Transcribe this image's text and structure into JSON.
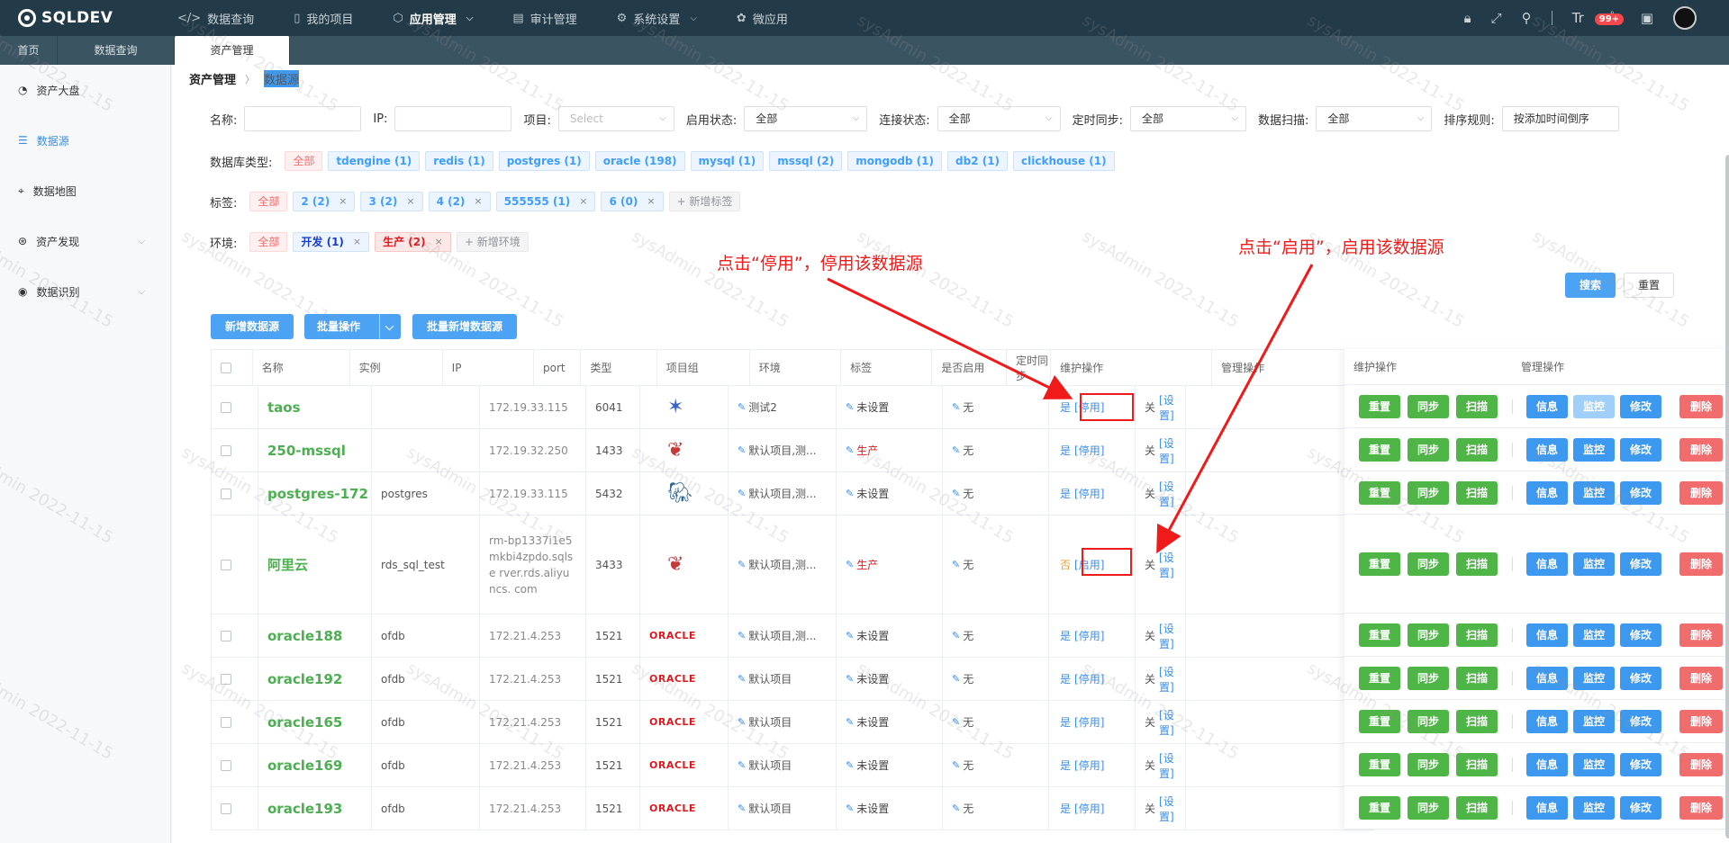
{
  "app": {
    "logo": "SQLDEV"
  },
  "nav": [
    {
      "label": "数据查询",
      "icon": "code-icon"
    },
    {
      "label": "我的项目",
      "icon": "folder-icon"
    },
    {
      "label": "应用管理",
      "icon": "cube-icon",
      "active": true,
      "has_menu": true
    },
    {
      "label": "审计管理",
      "icon": "doc-icon"
    },
    {
      "label": "系统设置",
      "icon": "gear-icon",
      "has_menu": true
    },
    {
      "label": "微应用",
      "icon": "flower-icon"
    }
  ],
  "toolbar": {
    "badge": "99+",
    "font_icon": "Tr"
  },
  "tabs": [
    {
      "label": "首页"
    },
    {
      "label": "数据查询"
    },
    {
      "label": "资产管理",
      "active": true
    }
  ],
  "sidebar": [
    {
      "label": "资产大盘",
      "icon": "pie-chart-icon"
    },
    {
      "label": "数据源",
      "icon": "database-icon",
      "active": true
    },
    {
      "label": "数据地图",
      "icon": "map-pin-icon"
    },
    {
      "label": "资产发现",
      "icon": "discover-icon",
      "has_menu": true
    },
    {
      "label": "数据识别",
      "icon": "eye-icon",
      "has_menu": true
    }
  ],
  "breadcrumb": {
    "root": "资产管理",
    "current": "数据源"
  },
  "filters": {
    "name_label": "名称:",
    "ip_label": "IP:",
    "project_label": "项目:",
    "project_placeholder": "Select",
    "enable_label": "启用状态:",
    "enable_value": "全部",
    "conn_label": "连接状态:",
    "conn_value": "全部",
    "sync_label": "定时同步:",
    "sync_value": "全部",
    "scan_label": "数据扫描:",
    "scan_value": "全部",
    "sort_label": "排序规则:",
    "sort_value": "按添加时间倒序"
  },
  "dbtypes": {
    "label": "数据库类型:",
    "all": "全部",
    "items": [
      "tdengine (1)",
      "redis (1)",
      "postgres (1)",
      "oracle (198)",
      "mysql (1)",
      "mssql (2)",
      "mongodb (1)",
      "db2 (1)",
      "clickhouse (1)"
    ]
  },
  "tags": {
    "label": "标签:",
    "all": "全部",
    "items": [
      "2 (2)",
      "3 (2)",
      "4 (2)",
      "555555 (1)",
      "6 (0)"
    ],
    "add": "+ 新增标签"
  },
  "envs": {
    "label": "环境:",
    "all": "全部",
    "dev": "开发 (1)",
    "prod": "生产 (2)",
    "add": "+ 新增环境"
  },
  "actions": {
    "search": "搜索",
    "reset": "重置",
    "new_ds": "新增数据源",
    "batch_ops": "批量操作",
    "batch_new": "批量新增数据源"
  },
  "annotations": {
    "disable": "点击“停用”，停用该数据源",
    "enable": "点击“启用”，启用该数据源"
  },
  "table": {
    "headers": [
      "名称",
      "实例",
      "IP",
      "port",
      "类型",
      "项目组",
      "环境",
      "标签",
      "是否启用",
      "定时同步",
      "维护操作",
      "管理操作"
    ],
    "rows": [
      {
        "name": "taos",
        "instance": "",
        "ip": "172.19.33.115",
        "port": "6041",
        "type": "tdengine",
        "project": "测试2",
        "env": "未设置",
        "env_prod": false,
        "tag": "无",
        "enabled": "是",
        "toggle": "[停用]",
        "sync": "关",
        "sync_link": "[设置]",
        "monitor_disabled": true
      },
      {
        "name": "250-mssql",
        "instance": "",
        "ip": "172.19.32.250",
        "port": "1433",
        "type": "mssql",
        "project": "默认项目,测...",
        "env": "生产",
        "env_prod": true,
        "tag": "无",
        "enabled": "是",
        "toggle": "[停用]",
        "sync": "关",
        "sync_link": "[设置]"
      },
      {
        "name": "postgres-172",
        "instance": "postgres",
        "ip": "172.19.33.115",
        "port": "5432",
        "type": "postgres",
        "project": "默认项目,测...",
        "env": "未设置",
        "env_prod": false,
        "tag": "无",
        "enabled": "是",
        "toggle": "[停用]",
        "sync": "关",
        "sync_link": "[设置]"
      },
      {
        "name": "阿里云",
        "instance": "rds_sql_test",
        "ip": "rm-bp1337i1e5 mkbi4zpdo.sqlse rver.rds.aliyuncs. com",
        "port": "3433",
        "type": "mssql",
        "project": "默认项目,测...",
        "env": "生产",
        "env_prod": true,
        "tag": "无",
        "enabled": "否",
        "toggle": "[启用]",
        "sync": "关",
        "sync_link": "[设置]",
        "tall": true
      },
      {
        "name": "oracle188",
        "instance": "ofdb",
        "ip": "172.21.4.253",
        "port": "1521",
        "type": "oracle",
        "project": "默认项目,测...",
        "env": "未设置",
        "env_prod": false,
        "tag": "无",
        "enabled": "是",
        "toggle": "[停用]",
        "sync": "关",
        "sync_link": "[设置]"
      },
      {
        "name": "oracle192",
        "instance": "ofdb",
        "ip": "172.21.4.253",
        "port": "1521",
        "type": "oracle",
        "project": "默认项目",
        "env": "未设置",
        "env_prod": false,
        "tag": "无",
        "enabled": "是",
        "toggle": "[停用]",
        "sync": "关",
        "sync_link": "[设置]"
      },
      {
        "name": "oracle165",
        "instance": "ofdb",
        "ip": "172.21.4.253",
        "port": "1521",
        "type": "oracle",
        "project": "默认项目",
        "env": "未设置",
        "env_prod": false,
        "tag": "无",
        "enabled": "是",
        "toggle": "[停用]",
        "sync": "关",
        "sync_link": "[设置]"
      },
      {
        "name": "oracle169",
        "instance": "ofdb",
        "ip": "172.21.4.253",
        "port": "1521",
        "type": "oracle",
        "project": "默认项目",
        "env": "未设置",
        "env_prod": false,
        "tag": "无",
        "enabled": "是",
        "toggle": "[停用]",
        "sync": "关",
        "sync_link": "[设置]"
      },
      {
        "name": "oracle193",
        "instance": "ofdb",
        "ip": "172.21.4.253",
        "port": "1521",
        "type": "oracle",
        "project": "默认项目",
        "env": "未设置",
        "env_prod": false,
        "tag": "无",
        "enabled": "是",
        "toggle": "[停用]",
        "sync": "关",
        "sync_link": "[设置]"
      }
    ],
    "op_labels": {
      "reset": "重置",
      "sync": "同步",
      "scan": "扫描",
      "info": "信息",
      "monitor": "监控",
      "edit": "修改",
      "delete": "删除"
    },
    "type_logo_text": {
      "oracle": "ORACLE"
    }
  },
  "watermark": "sysAdmin 2022-11-15",
  "colors": {
    "topbar": "#233b48",
    "tabbar": "#3b5461",
    "green": "#4fb546",
    "blue": "#3d98ef",
    "red": "#f16d6d",
    "annotation": "#f01a1a"
  }
}
